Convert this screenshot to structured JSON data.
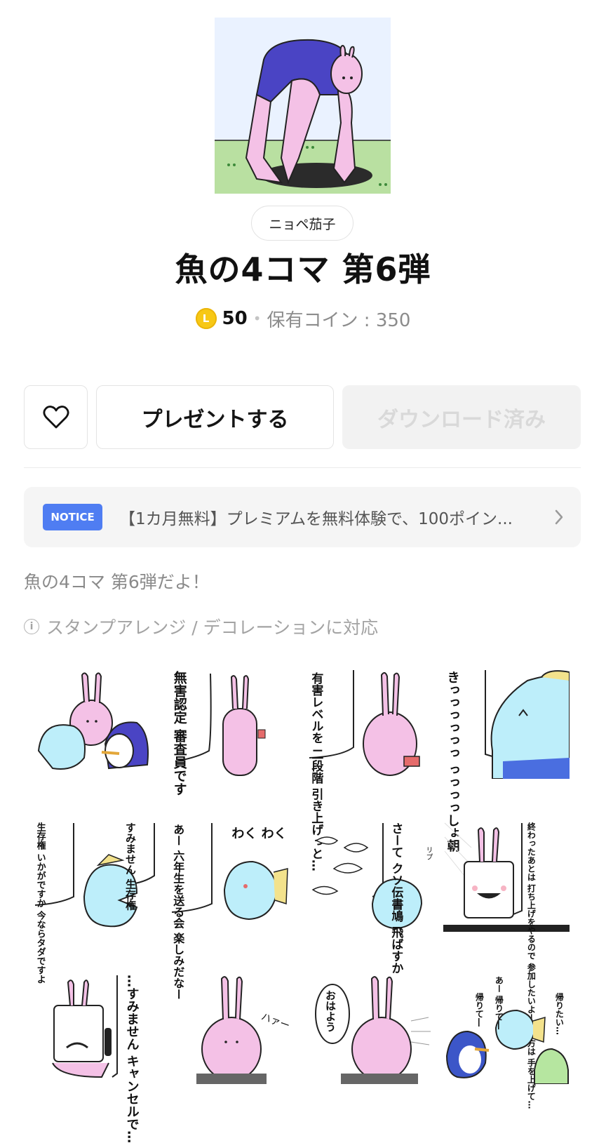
{
  "author": "ニョペ茄子",
  "title": "魚の4コマ 第6弾",
  "price": {
    "coin_symbol": "L",
    "amount": "50",
    "separator": "•",
    "owned_label": "保有コイン : 350"
  },
  "actions": {
    "gift_label": "プレゼントする",
    "download_label": "ダウンロード済み"
  },
  "notice": {
    "badge": "NOTICE",
    "text": "【1カ月無料】プレミアムを無料体験で、100ポイン..."
  },
  "description": "魚の4コマ 第6弾だよ！",
  "feature": {
    "icon": "i",
    "text": "スタンプアレンジ / デコレーションに対応"
  },
  "stickers": {
    "s2": "無害認定 審査員です",
    "s3": "有害レベルを 二段階 引き上げっと…",
    "s4": "きっっっっっっ っっっっしょ朝",
    "s5a": "すみません 生存権",
    "s5b": "生存権 いかがですか 今ならタダですよ",
    "s6a": "あー 六年生を送る会 楽しみだなー",
    "s6b": "わく わく",
    "s7": "さーて クソ伝書鳩 飛ばすか",
    "s7_ruby": "リプ",
    "s8": "終わったあとは 打ち上げをやるので 参加したいよーって方は 手を上げて…",
    "s9": "…すみません キャンセルで…",
    "s10": "ハァー",
    "s11": "おはよう",
    "s12a": "帰りて―",
    "s12b": "あー 帰りて―",
    "s12c": "帰りたい…"
  },
  "colors": {
    "accent": "#4f7df2",
    "coin": "#f7c815",
    "rabbit_pink": "#f4c1e6",
    "fish_blue": "#bdeefa",
    "suit_blue": "#4a44c4"
  }
}
